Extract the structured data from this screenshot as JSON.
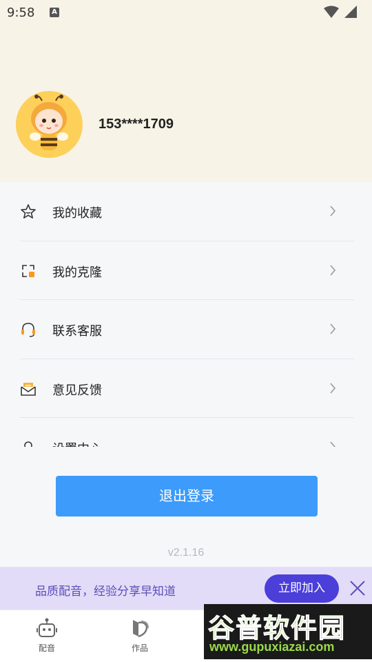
{
  "status_bar": {
    "time": "9:58",
    "notification_icon": "A"
  },
  "profile": {
    "phone": "153****1709"
  },
  "menu": [
    {
      "label": "我的收藏",
      "icon": "star-icon"
    },
    {
      "label": "我的克隆",
      "icon": "clone-icon"
    },
    {
      "label": "联系客服",
      "icon": "headset-icon"
    },
    {
      "label": "意见反馈",
      "icon": "feedback-mail-icon"
    },
    {
      "label": "设置中心",
      "icon": "settings-icon"
    }
  ],
  "logout_label": "退出登录",
  "version": "v2.1.16",
  "promo": {
    "text": "品质配音，经验分享早知道",
    "join_label": "立即加入"
  },
  "tabs": [
    {
      "label": "配音",
      "icon": "robot-icon"
    },
    {
      "label": "作品",
      "icon": "works-icon"
    }
  ],
  "watermark": {
    "title": "谷普软件园",
    "url": "www.gupuxiazai.com"
  },
  "colors": {
    "header_bg": "#f8f3e7",
    "primary": "#3c9bfb",
    "promo_bg": "#e3dcf8",
    "promo_button": "#4b3ed9"
  }
}
